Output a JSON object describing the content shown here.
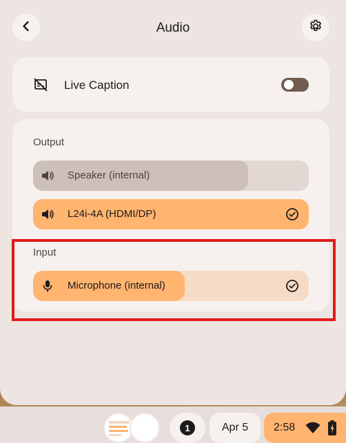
{
  "header": {
    "title": "Audio",
    "back_icon": "chevron-left-icon",
    "settings_icon": "gear-icon"
  },
  "live_caption": {
    "label": "Live Caption",
    "icon": "live-caption-icon",
    "toggle_on": false
  },
  "output": {
    "label": "Output",
    "devices": [
      {
        "name": "Speaker (internal)",
        "icon": "volume-icon",
        "level": 0.78,
        "selected": false
      },
      {
        "name": "L24i-4A (HDMI/DP)",
        "icon": "volume-icon",
        "level": 1.0,
        "selected": true
      }
    ]
  },
  "input": {
    "label": "Input",
    "devices": [
      {
        "name": "Microphone (internal)",
        "icon": "microphone-icon",
        "level": 0.55,
        "selected": true
      }
    ]
  },
  "shelf": {
    "notification_count": "1",
    "date": "Apr 5",
    "time": "2:58",
    "wifi_icon": "wifi-icon",
    "battery_icon": "battery-charging-icon"
  },
  "colors": {
    "accent": "#ffb470",
    "panel": "#ede5e1",
    "card": "#f6f1ef",
    "highlight": "#e01b1b"
  }
}
